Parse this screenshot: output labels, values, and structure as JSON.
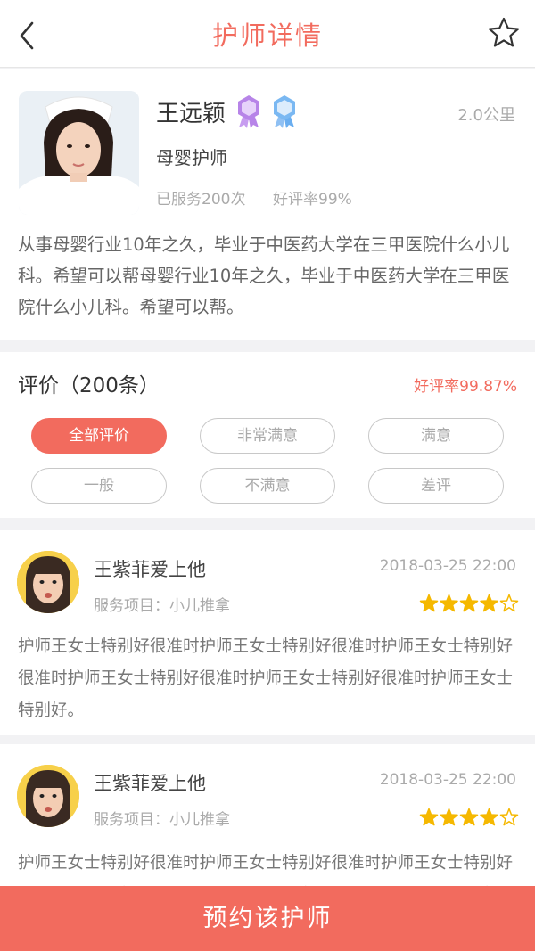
{
  "nav": {
    "title": "护师详情",
    "back_icon": "chevron-left-icon",
    "favorite_icon": "star-outline-icon"
  },
  "nurse": {
    "name": "王远颖",
    "distance": "2.0公里",
    "role": "母婴护师",
    "served": "已服务200次",
    "good_rate": "好评率99%",
    "bio": "从事母婴行业10年之久，毕业于中医药大学在三甲医院什么小儿科。希望可以帮母婴行业10年之久，毕业于中医药大学在三甲医院什么小儿科。希望可以帮。",
    "badges": [
      "medal-badge-purple-icon",
      "medal-badge-blue-icon"
    ]
  },
  "reviews": {
    "title": "评价（200条）",
    "good_rate": "好评率99.87%",
    "filters": [
      {
        "label": "全部评价",
        "active": true
      },
      {
        "label": "非常满意",
        "active": false
      },
      {
        "label": "满意",
        "active": false
      },
      {
        "label": "一般",
        "active": false
      },
      {
        "label": "不满意",
        "active": false
      },
      {
        "label": "差评",
        "active": false
      }
    ],
    "items": [
      {
        "user": "王紫菲爱上他",
        "date": "2018-03-25 22:00",
        "service": "服务项目：小儿推拿",
        "rating": 4,
        "rating_max": 5,
        "content": "护师王女士特别好很准时护师王女士特别好很准时护师王女士特别好很准时护师王女士特别好很准时护师王女士特别好很准时护师王女士特别好。"
      },
      {
        "user": "王紫菲爱上他",
        "date": "2018-03-25 22:00",
        "service": "服务项目：小儿推拿",
        "rating": 4,
        "rating_max": 5,
        "content": "护师王女士特别好很准时护师王女士特别好很准时护师王女士特别好很准时护师王女士特别好很准时护师王女士特别好很准时护师王女士特别好。"
      }
    ]
  },
  "footer": {
    "book_label": "预约该护师"
  },
  "colors": {
    "accent": "#f26b5e",
    "star": "#f5b800",
    "page_bg": "#f2f2f4"
  }
}
